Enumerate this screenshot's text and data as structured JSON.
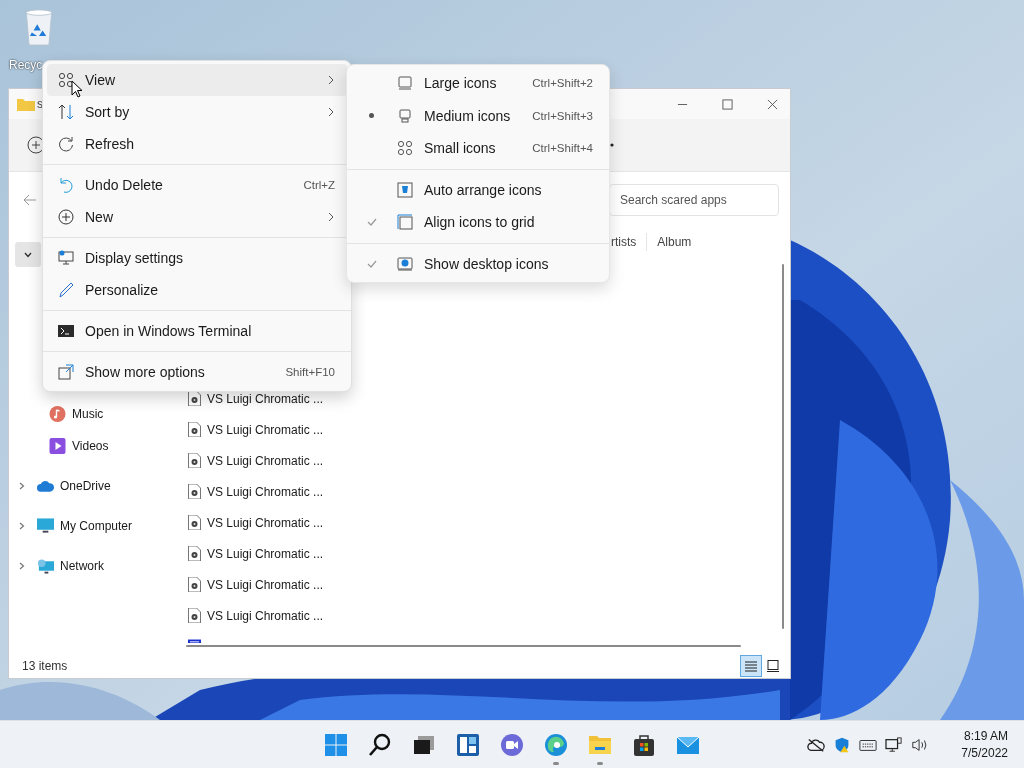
{
  "desktop_icons": [
    {
      "label": "Recyc"
    }
  ],
  "explorer": {
    "title": "s",
    "search": {
      "placeholder": "Search scared apps"
    },
    "columns": [
      "rtists",
      "Album"
    ],
    "sidebar": [
      {
        "selected": true,
        "expanded": true,
        "children": [
          {
            "label": "Music"
          },
          {
            "label": "Videos"
          }
        ]
      },
      {
        "label": "OneDrive",
        "selected": false,
        "expanded": false
      },
      {
        "label": "My Computer",
        "selected": false,
        "expanded": false
      },
      {
        "label": "Network",
        "selected": false,
        "expanded": false
      }
    ],
    "files": [
      {
        "name": "VS Luigi Chromatic ..."
      },
      {
        "name": "VS Luigi Chromatic ..."
      },
      {
        "name": "VS Luigi Chromatic ..."
      },
      {
        "name": "VS Luigi Chromatic ..."
      },
      {
        "name": "VS Luigi Chromatic ..."
      },
      {
        "name": "VS Luigi Chromatic ..."
      },
      {
        "name": "VS Luigi Chromatic ..."
      },
      {
        "name": "VS Luigi Chromatic ..."
      }
    ],
    "status": "13 items",
    "view_buttons": [
      {
        "selected": true
      },
      {
        "selected": false
      }
    ]
  },
  "context_menu": [
    {
      "kind": "item",
      "label": "View",
      "submenu": true,
      "hovered": true
    },
    {
      "kind": "item",
      "label": "Sort by",
      "submenu": true,
      "hovered": false
    },
    {
      "kind": "item",
      "label": "Refresh",
      "submenu": false,
      "hovered": false
    },
    {
      "kind": "separator"
    },
    {
      "kind": "item",
      "label": "Undo Delete",
      "shortcut": "Ctrl+Z",
      "submenu": false,
      "hovered": false
    },
    {
      "kind": "item",
      "label": "New",
      "submenu": true,
      "hovered": false
    },
    {
      "kind": "separator"
    },
    {
      "kind": "item",
      "label": "Display settings",
      "submenu": false,
      "hovered": false
    },
    {
      "kind": "item",
      "label": "Personalize",
      "submenu": false,
      "hovered": false
    },
    {
      "kind": "separator"
    },
    {
      "kind": "item",
      "label": "Open in Windows Terminal",
      "submenu": false,
      "hovered": false
    },
    {
      "kind": "separator"
    },
    {
      "kind": "item",
      "label": "Show more options",
      "shortcut": "Shift+F10",
      "submenu": false,
      "hovered": false
    }
  ],
  "view_submenu": [
    {
      "kind": "item",
      "label": "Large icons",
      "shortcut": "Ctrl+Shift+2",
      "selected": false
    },
    {
      "kind": "item",
      "label": "Medium icons",
      "shortcut": "Ctrl+Shift+3",
      "selected": true
    },
    {
      "kind": "item",
      "label": "Small icons",
      "shortcut": "Ctrl+Shift+4",
      "selected": false
    },
    {
      "kind": "separator"
    },
    {
      "kind": "item",
      "label": "Auto arrange icons",
      "checked": false
    },
    {
      "kind": "item",
      "label": "Align icons to grid",
      "checked": true
    },
    {
      "kind": "separator"
    },
    {
      "kind": "item",
      "label": "Show desktop icons",
      "checked": true
    }
  ],
  "taskbar": {
    "apps": [
      {
        "running": false
      },
      {
        "running": false
      },
      {
        "running": false
      },
      {
        "running": false
      },
      {
        "running": false
      },
      {
        "running": true
      },
      {
        "running": true
      },
      {
        "running": false
      },
      {
        "running": false
      }
    ],
    "time": "8:19 AM",
    "date": "7/5/2022"
  }
}
